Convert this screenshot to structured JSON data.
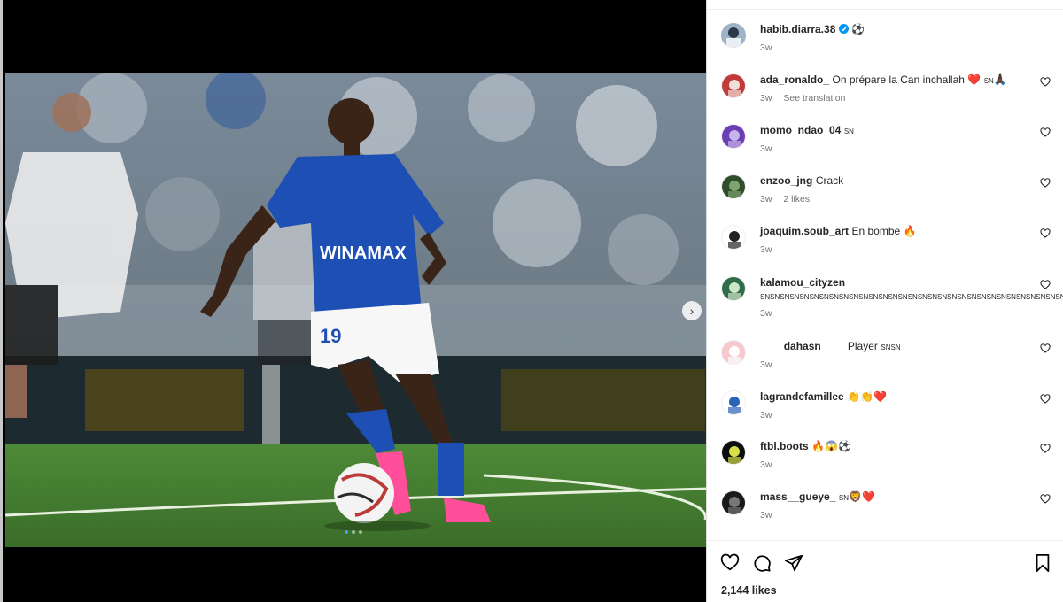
{
  "post": {
    "author": "habib.diarra.38",
    "author_emoji": "⚽",
    "author_time": "3w",
    "jersey_sponsor": "WINAMAX",
    "jersey_number": "19",
    "likes": "2,144 likes"
  },
  "comments": [
    {
      "user": "ada_ronaldo_",
      "text": "On prépare la Can inchallah ❤️",
      "suffix": "SN",
      "emoji": "🙏🏿",
      "time": "3w",
      "extra": "See translation"
    },
    {
      "user": "momo_ndao_04",
      "text": "",
      "suffix": "SN",
      "emoji": "",
      "time": "3w",
      "extra": ""
    },
    {
      "user": "enzoo_jng",
      "text": "Crack",
      "suffix": "",
      "emoji": "",
      "time": "3w",
      "extra": "2 likes"
    },
    {
      "user": "joaquim.soub_art",
      "text": "En bombe 🔥",
      "suffix": "",
      "emoji": "",
      "time": "3w",
      "extra": ""
    },
    {
      "user": "kalamou_cityzen",
      "text": "",
      "suffix": "SNSNSNSNSNSNSNSNSNSNSNSNSNSNSNSNSNSNSNSNSNSNSNSNSNSNSNSNSNSNSN",
      "emoji": "",
      "time": "3w",
      "extra": ""
    },
    {
      "user": "____dahasn____",
      "text": "Player",
      "suffix": "SNSN",
      "emoji": "",
      "time": "3w",
      "extra": ""
    },
    {
      "user": "lagrandefamillee",
      "text": "👏👏❤️",
      "suffix": "",
      "emoji": "",
      "time": "3w",
      "extra": ""
    },
    {
      "user": "ftbl.boots",
      "text": "🔥😱⚽",
      "suffix": "",
      "emoji": "",
      "time": "3w",
      "extra": ""
    },
    {
      "user": "mass__gueye_",
      "text": "",
      "suffix": "SN",
      "emoji": "🦁❤️",
      "time": "3w",
      "extra": ""
    }
  ],
  "colors": {
    "accent": "#0095f6",
    "jersey": "#1d4fb5",
    "pitch": "#3f7a2f"
  }
}
